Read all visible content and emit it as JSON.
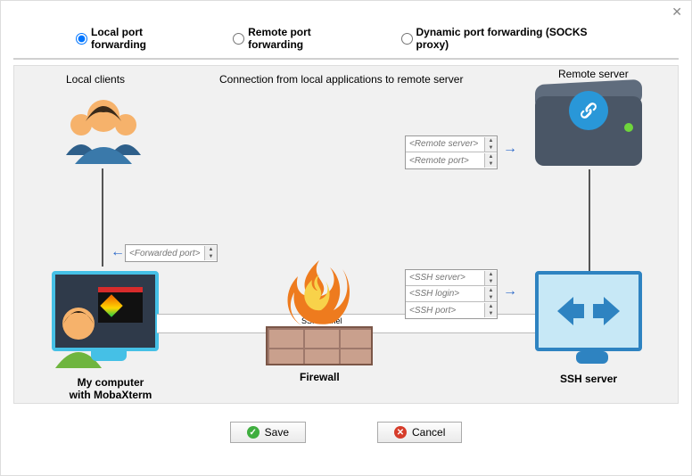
{
  "radios": {
    "local": "Local port forwarding",
    "remote": "Remote port forwarding",
    "dynamic": "Dynamic port forwarding (SOCKS proxy)",
    "selected": "local"
  },
  "labels": {
    "local_clients": "Local clients",
    "connection_desc": "Connection from local applications to remote server",
    "remote_server": "Remote server",
    "my_computer_l1": "My computer",
    "my_computer_l2": "with MobaXterm",
    "firewall": "Firewall",
    "ssh_tunnel": "SSH tunnel",
    "ssh_server": "SSH server"
  },
  "fields": {
    "forwarded_port": "<Forwarded port>",
    "remote_server": "<Remote server>",
    "remote_port": "<Remote port>",
    "ssh_server": "<SSH server>",
    "ssh_login": "<SSH login>",
    "ssh_port": "<SSH port>"
  },
  "buttons": {
    "save": "Save",
    "cancel": "Cancel"
  },
  "colors": {
    "accent_blue": "#2b7fb5",
    "monitor_cyan": "#45c0e6",
    "ssh_blue": "#2e83c1"
  }
}
